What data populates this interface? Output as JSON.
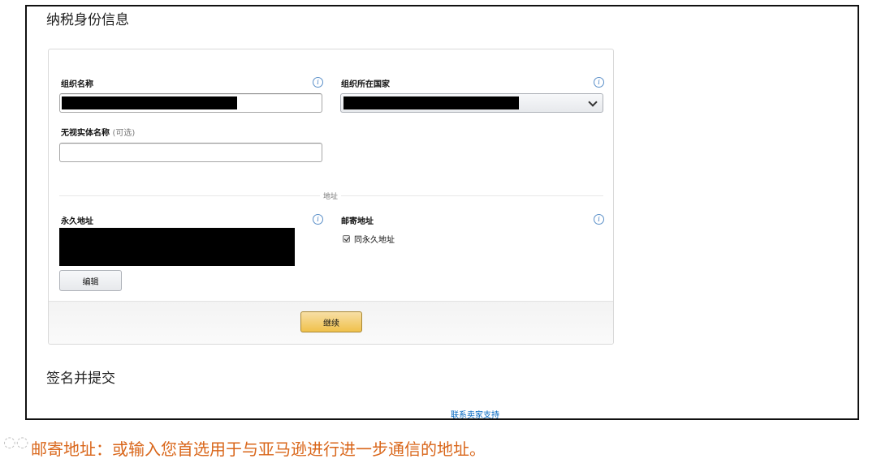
{
  "page": {
    "tax_section_title": "纳税身份信息",
    "sign_section_title": "签名并提交",
    "support_link": "联系卖家支持"
  },
  "form": {
    "org_name_label": "组织名称",
    "org_country_label": "组织所在国家",
    "dba_label": "无视实体名称",
    "dba_optional": "(可选)",
    "dba_value": "",
    "address_divider": "地址",
    "permanent_address_label": "永久地址",
    "mailing_address_label": "邮寄地址",
    "same_as_permanent_label": "同永久地址",
    "same_as_permanent_checked": true,
    "edit_button": "编辑",
    "continue_button": "继续"
  },
  "icons": {
    "info": "i"
  },
  "caption": {
    "text": "邮寄地址：或输入您首选用于与亚马逊进行进一步通信的地址。",
    "color": "#d9661a"
  },
  "theme": {
    "link_color": "#0066c0",
    "primary_button": "#f0c14b",
    "info_icon_color": "#3a78c0"
  }
}
